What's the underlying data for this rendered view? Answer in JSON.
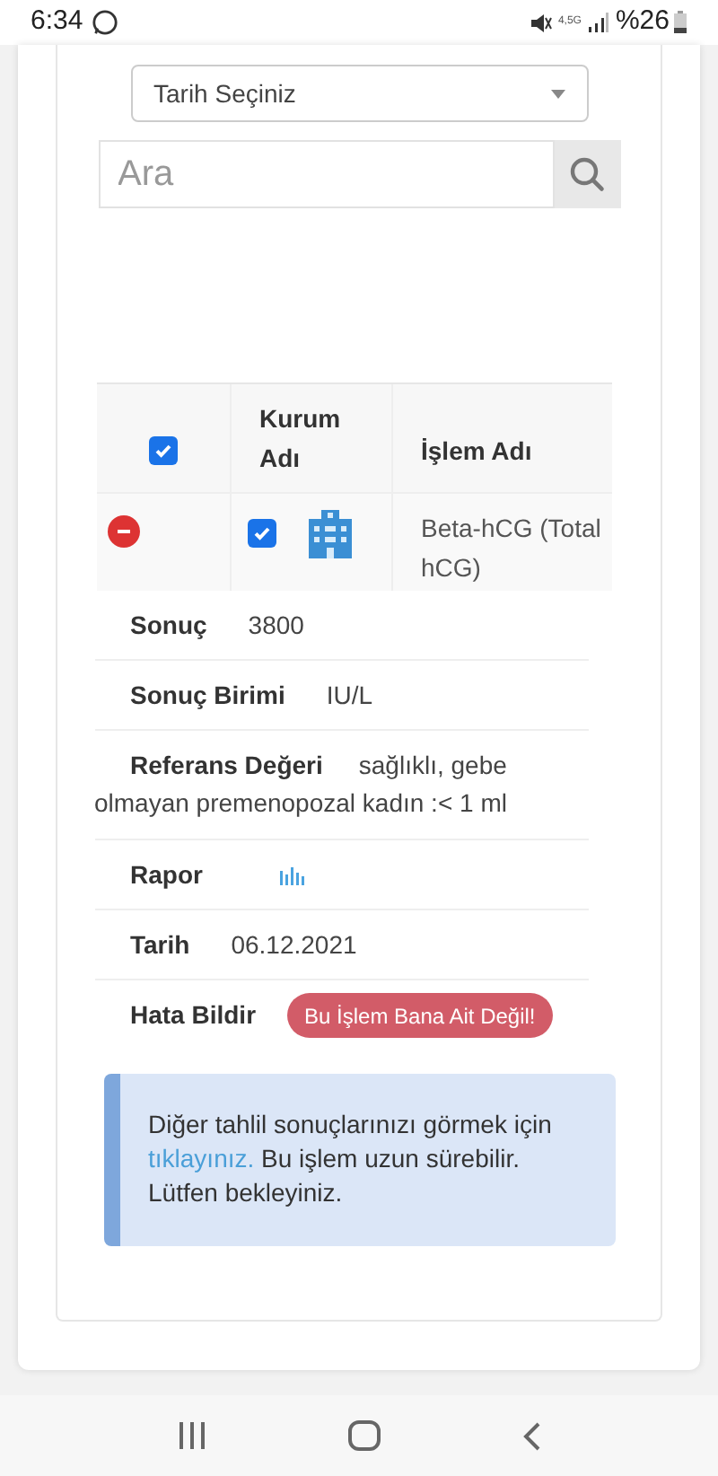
{
  "status_bar": {
    "time": "6:34",
    "network": "4,5G",
    "battery": "%26"
  },
  "date_select": {
    "placeholder": "Tarih Seçiniz"
  },
  "search": {
    "placeholder": "Ara"
  },
  "table": {
    "select_all": {
      "checked": true
    },
    "columns": [
      "Kurum Adı",
      "İşlem Adı"
    ],
    "rows": [
      {
        "checked": true,
        "name": "Beta-hCG (Total hCG)"
      }
    ]
  },
  "details": [
    {
      "kind": "text",
      "label": "Sonuç",
      "value": "3800"
    },
    {
      "kind": "text",
      "label": "Sonuç Birimi",
      "value": "IU/L"
    },
    {
      "kind": "text",
      "label": "Referans Değeri",
      "value": "sağlıklı, gebe olmayan premenopozal kadın :< 1 ml"
    },
    {
      "kind": "chart",
      "label": "Rapor"
    },
    {
      "kind": "text",
      "label": "Tarih",
      "value": "06.12.2021"
    },
    {
      "kind": "button",
      "label": "Hata Bildir",
      "value": "Bu İşlem Bana Ait Değil!"
    }
  ],
  "alert": {
    "before": "Diğer tahlil sonuçlarınızı görmek için",
    "link": "tıklayınız.",
    "after": "Bu işlem uzun sürebilir. Lütfen bekleyiniz."
  }
}
